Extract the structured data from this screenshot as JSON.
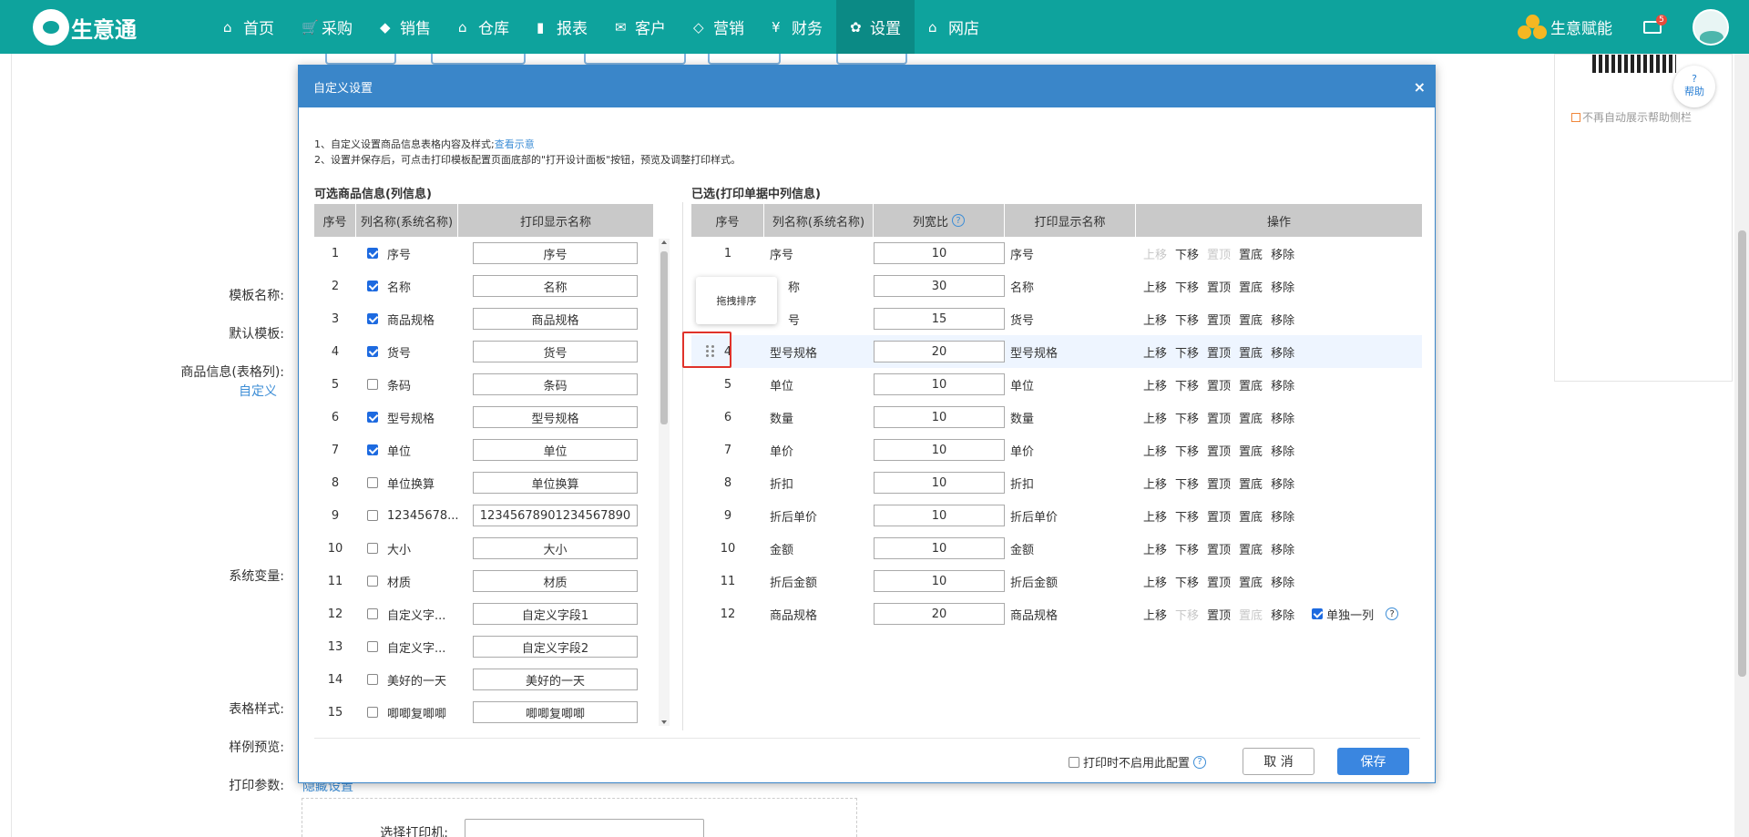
{
  "nav": {
    "logo": "生意通",
    "items": [
      {
        "label": "首页",
        "icon": "home-icon"
      },
      {
        "label": "采购",
        "icon": "cart-icon"
      },
      {
        "label": "销售",
        "icon": "tag-icon"
      },
      {
        "label": "仓库",
        "icon": "warehouse-icon"
      },
      {
        "label": "报表",
        "icon": "clipboard-icon"
      },
      {
        "label": "客户",
        "icon": "mail-icon"
      },
      {
        "label": "营销",
        "icon": "price-tag-icon"
      },
      {
        "label": "财务",
        "icon": "yen-icon"
      },
      {
        "label": "设置",
        "icon": "gear-icon"
      },
      {
        "label": "网店",
        "icon": "shop-icon"
      }
    ],
    "active_index": 8,
    "empower": "生意赋能",
    "mail_badge": "5"
  },
  "background": {
    "labels": [
      "模板名称:",
      "默认模板:",
      "商品信息(表格列):",
      "系统变量:",
      "表格样式:",
      "样例预览:",
      "打印参数:",
      "选择打印机:"
    ],
    "custom_link": "自定义",
    "hidden_settings_link": "隐藏设置",
    "help_label": "帮助",
    "no_auto_show": "不再自动展示帮助侧栏"
  },
  "modal": {
    "title": "自定义设置",
    "close": "×",
    "intro_line1": "1、自定义设置商品信息表格内容及样式;",
    "intro_link": "查看示意",
    "intro_line2": "2、设置并保存后，可点击打印模板配置页面底部的\"打开设计面板\"按钮，预览及调整打印样式。",
    "left_title": "可选商品信息(列信息)",
    "right_title": "已选(打印单据中列信息)",
    "left_headers": [
      "序号",
      "列名称(系统名称)",
      "打印显示名称"
    ],
    "right_headers": [
      "序号",
      "列名称(系统名称)",
      "列宽比",
      "打印显示名称",
      "操作"
    ],
    "left_rows": [
      {
        "no": "1",
        "name": "序号",
        "checked": true,
        "display": "序号"
      },
      {
        "no": "2",
        "name": "名称",
        "checked": true,
        "display": "名称"
      },
      {
        "no": "3",
        "name": "商品规格",
        "checked": true,
        "display": "商品规格"
      },
      {
        "no": "4",
        "name": "货号",
        "checked": true,
        "display": "货号"
      },
      {
        "no": "5",
        "name": "条码",
        "checked": false,
        "display": "条码"
      },
      {
        "no": "6",
        "name": "型号规格",
        "checked": true,
        "display": "型号规格"
      },
      {
        "no": "7",
        "name": "单位",
        "checked": true,
        "display": "单位"
      },
      {
        "no": "8",
        "name": "单位换算",
        "checked": false,
        "display": "单位换算"
      },
      {
        "no": "9",
        "name": "12345678...",
        "checked": false,
        "display": "12345678901234567890"
      },
      {
        "no": "10",
        "name": "大小",
        "checked": false,
        "display": "大小"
      },
      {
        "no": "11",
        "name": "材质",
        "checked": false,
        "display": "材质"
      },
      {
        "no": "12",
        "name": "自定义字...",
        "checked": false,
        "display": "自定义字段1"
      },
      {
        "no": "13",
        "name": "自定义字...",
        "checked": false,
        "display": "自定义字段2"
      },
      {
        "no": "14",
        "name": "美好的一天",
        "checked": false,
        "display": "美好的一天"
      },
      {
        "no": "15",
        "name": "唧唧复唧唧",
        "checked": false,
        "display": "唧唧复唧唧"
      }
    ],
    "right_rows": [
      {
        "no": "1",
        "name": "序号",
        "width": "10",
        "display": "序号"
      },
      {
        "no": "",
        "name": "称",
        "width": "30",
        "display": "名称"
      },
      {
        "no": "",
        "name": "号",
        "width": "15",
        "display": "货号"
      },
      {
        "no": "4",
        "name": "型号规格",
        "width": "20",
        "display": "型号规格"
      },
      {
        "no": "5",
        "name": "单位",
        "width": "10",
        "display": "单位"
      },
      {
        "no": "6",
        "name": "数量",
        "width": "10",
        "display": "数量"
      },
      {
        "no": "7",
        "name": "单价",
        "width": "10",
        "display": "单价"
      },
      {
        "no": "8",
        "name": "折扣",
        "width": "10",
        "display": "折扣"
      },
      {
        "no": "9",
        "name": "折后单价",
        "width": "10",
        "display": "折后单价"
      },
      {
        "no": "10",
        "name": "金额",
        "width": "10",
        "display": "金额"
      },
      {
        "no": "11",
        "name": "折后金额",
        "width": "10",
        "display": "折后金额"
      },
      {
        "no": "12",
        "name": "商品规格",
        "width": "20",
        "display": "商品规格"
      }
    ],
    "ops": [
      "上移",
      "下移",
      "置顶",
      "置底",
      "移除"
    ],
    "single_column": "单独一列",
    "drag_tip": "拖拽排序",
    "footer_check": "打印时不启用此配置",
    "cancel": "取 消",
    "save": "保存"
  }
}
